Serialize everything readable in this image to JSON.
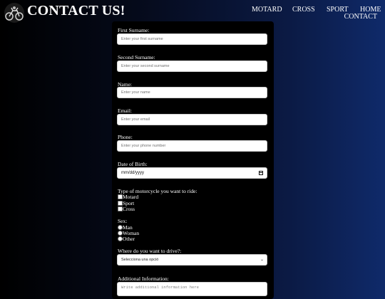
{
  "header": {
    "title": "CONTACT US!",
    "nav": [
      "MOTARD",
      "CROSS",
      "SPORT",
      "HOME",
      "CONTACT"
    ]
  },
  "form": {
    "first_surname": {
      "label": "First Surname:",
      "placeholder": "Enter your first surname"
    },
    "second_surname": {
      "label": "Second Surname:",
      "placeholder": "Enter your second surname"
    },
    "name": {
      "label": "Name:",
      "placeholder": "Enter your name"
    },
    "email": {
      "label": "Email:",
      "placeholder": "Enter your email"
    },
    "phone": {
      "label": "Phone:",
      "placeholder": "Enter your phone number"
    },
    "dob": {
      "label": "Date of Birth:",
      "value": "mm/dd/yyyy"
    },
    "motorcycle": {
      "label": "Type of motorcycle you want to ride:",
      "options": [
        "Motard",
        "Sport",
        "Cross"
      ]
    },
    "sex": {
      "label": "Sex:",
      "options": [
        "Man",
        "Woman",
        "Other"
      ]
    },
    "drive": {
      "label": "Where do you want to drive?:",
      "selected": "Selecciona una opció"
    },
    "additional": {
      "label": "Additional Information:",
      "placeholder": "Write additional information here"
    }
  }
}
